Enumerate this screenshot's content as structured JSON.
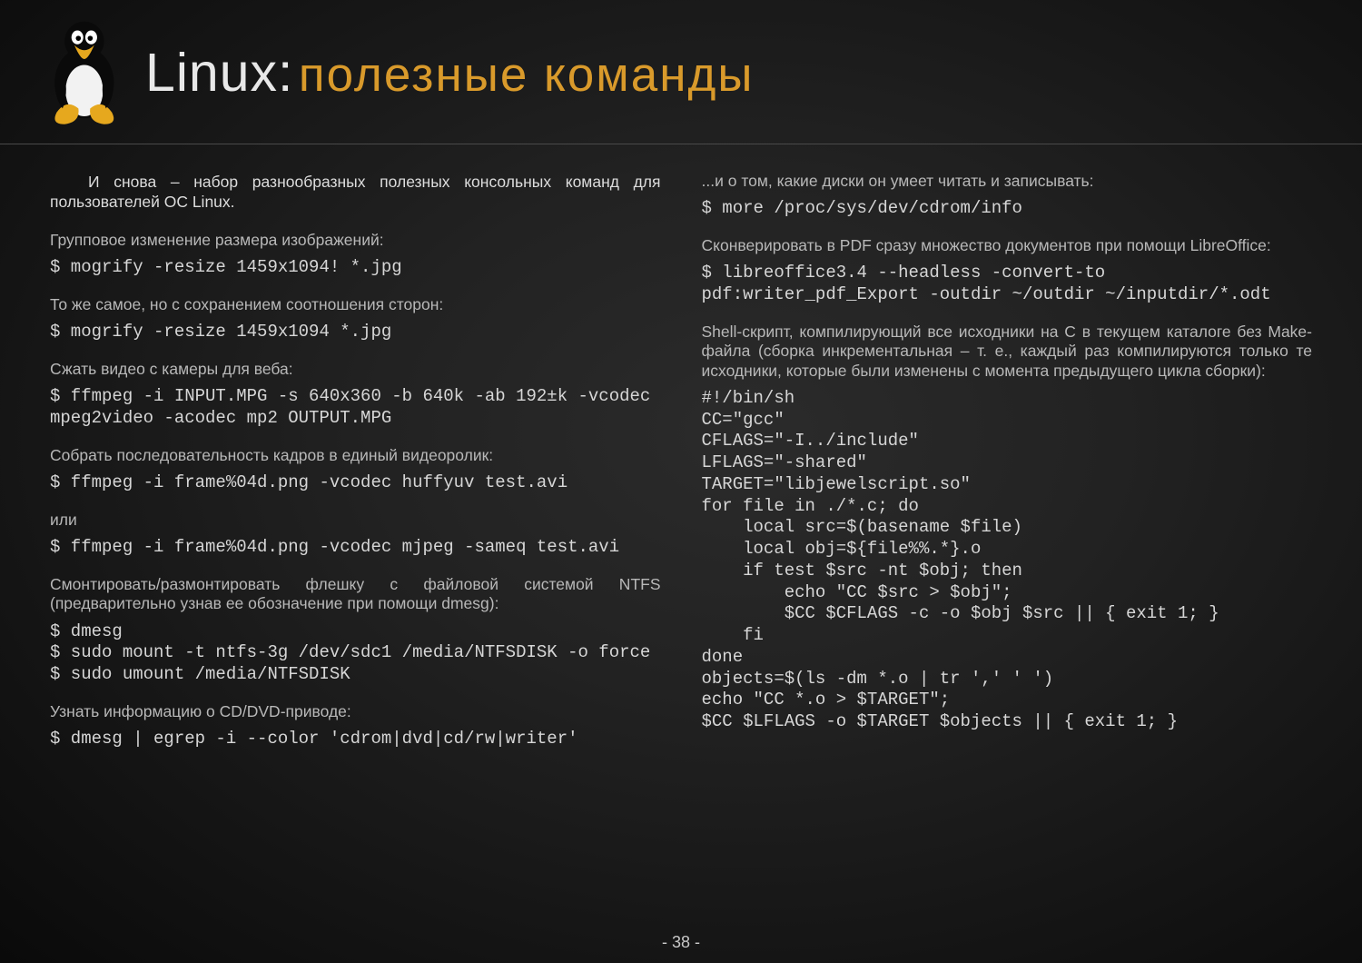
{
  "header": {
    "title_prefix": "Linux:",
    "title_main": "полезные команды"
  },
  "page_number": "- 38 -",
  "left": {
    "intro": "И снова – набор разнообразных полезных консольных команд для пользователей ОС Linux.",
    "d1": "Групповое изменение размера изображений:",
    "c1": "$ mogrify -resize 1459x1094! *.jpg",
    "d2": "То же самое, но с сохранением соотношения сторон:",
    "c2": "$ mogrify -resize 1459x1094 *.jpg",
    "d3": "Сжать видео с камеры для веба:",
    "c3": "$ ffmpeg -i INPUT.MPG -s 640x360 -b 640k -ab 192±k -vcodec mpeg2video -acodec mp2 OUTPUT.MPG",
    "d4": "Собрать последовательность кадров в единый видеоролик:",
    "c4": "$ ffmpeg -i frame%04d.png -vcodec huffyuv test.avi",
    "d5": "или",
    "c5": "$ ffmpeg -i frame%04d.png -vcodec mjpeg -sameq test.avi",
    "d6": "Смонтировать/размонтировать флешку с файловой системой NTFS (предварительно узнав ее обозначение при помощи dmesg):",
    "c6": "$ dmesg\n$ sudo mount -t ntfs-3g /dev/sdc1 /media/NTFSDISK -o force\n$ sudo umount /media/NTFSDISK",
    "d7": "Узнать информацию о CD/DVD-приводе:",
    "c7": "$ dmesg | egrep -i --color 'cdrom|dvd|cd/rw|writer'"
  },
  "right": {
    "d1": "...и о том, какие диски он умеет читать и записывать:",
    "c1": "$ more /proc/sys/dev/cdrom/info",
    "d2": "Сконверировать в PDF сразу множество документов при помощи LibreOffice:",
    "c2": "$ libreoffice3.4 --headless -convert-to pdf:writer_pdf_Export -outdir ~/outdir ~/inputdir/*.odt",
    "d3": "Shell-скрипт, компилирующий все исходники на C в текущем каталоге без Make-файла (сборка инкрементальная – т. е., каждый раз компилируются только те исходники, которые были изменены с момента предыдущего цикла сборки):",
    "c3": "#!/bin/sh\nCC=\"gcc\"\nCFLAGS=\"-I../include\"\nLFLAGS=\"-shared\"\nTARGET=\"libjewelscript.so\"\nfor file in ./*.c; do\n    local src=$(basename $file)\n    local obj=${file%%.*}.o\n    if test $src -nt $obj; then\n        echo \"CC $src > $obj\";\n        $CC $CFLAGS -c -o $obj $src || { exit 1; }\n    fi\ndone\nobjects=$(ls -dm *.o | tr ',' ' ')\necho \"CC *.o > $TARGET\";\n$CC $LFLAGS -o $TARGET $objects || { exit 1; }"
  }
}
